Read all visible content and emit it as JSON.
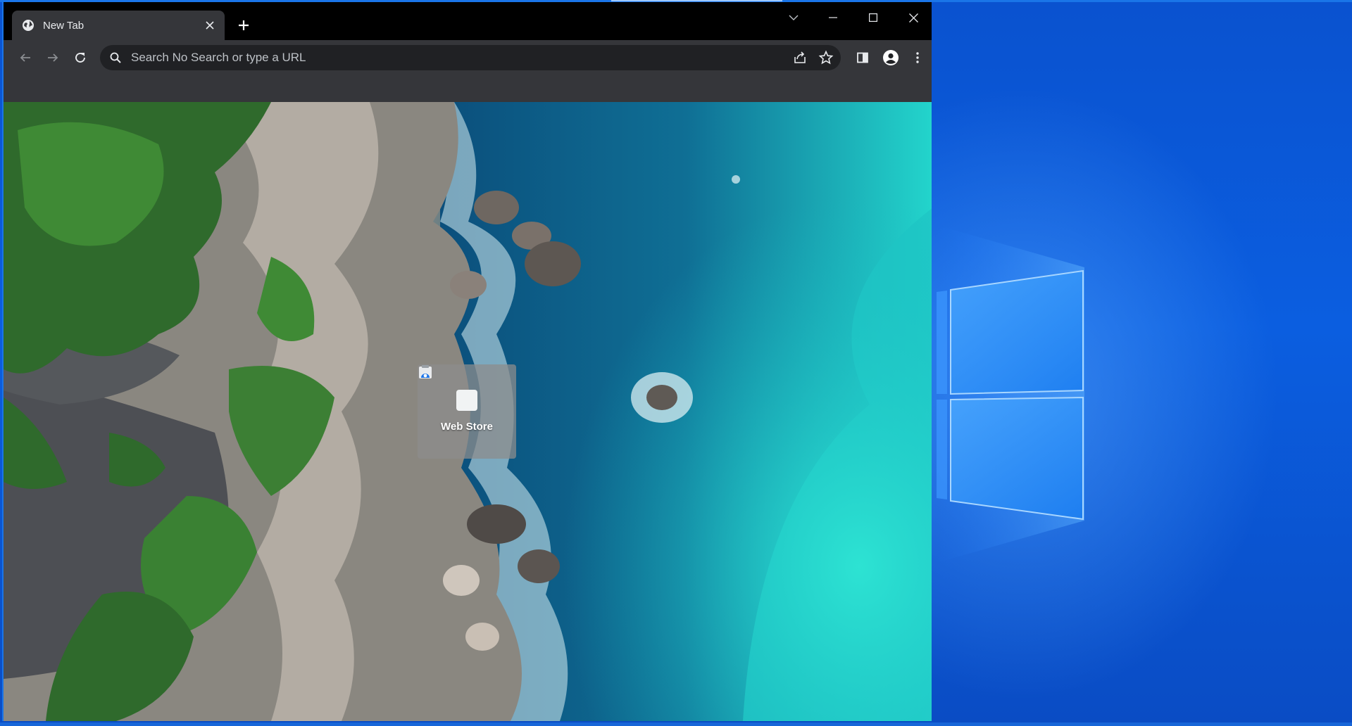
{
  "colors": {
    "desktop_bg": "#0b5ee0",
    "window_accent": "#1a75e8",
    "tabstrip_bg": "#000000",
    "toolbar_bg": "#35363a",
    "omnibox_bg": "#202124",
    "text_primary": "#e8eaed"
  },
  "tab": {
    "title": "New Tab",
    "favicon": "globe-icon",
    "close_icon": "close-icon"
  },
  "tabstrip": {
    "new_tab_icon": "plus-icon",
    "tab_search_icon": "chevron-down-icon"
  },
  "window_controls": {
    "minimize_icon": "minimize-icon",
    "maximize_icon": "maximize-icon",
    "close_icon": "close-icon"
  },
  "toolbar": {
    "back_icon": "arrow-left-icon",
    "forward_icon": "arrow-right-icon",
    "reload_icon": "reload-icon",
    "omnibox": {
      "placeholder": "Search No Search or type a URL",
      "value": "",
      "search_icon": "search-icon",
      "share_icon": "share-icon",
      "bookmark_icon": "star-icon"
    },
    "side_panel_icon": "side-panel-icon",
    "profile_icon": "account-circle-icon",
    "menu_icon": "kebab-menu-icon"
  },
  "ntp": {
    "background_image": "aerial-rocky-coastline",
    "shortcuts": [
      {
        "label": "Web Store",
        "icon": "web-store-icon"
      }
    ]
  },
  "desktop": {
    "wallpaper": "windows-10-hero-logo"
  }
}
